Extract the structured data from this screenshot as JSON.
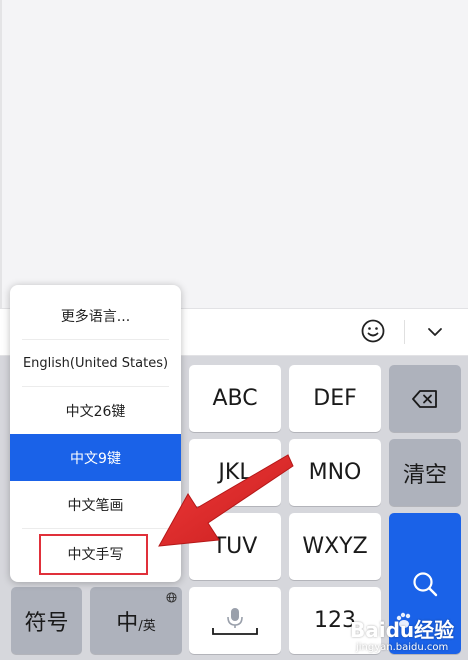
{
  "toolbar": {
    "emoji_icon": "smiley-icon",
    "collapse_icon": "chevron-down-icon"
  },
  "language_menu": {
    "items": [
      {
        "label": "更多语言..."
      },
      {
        "label": "English(United States)"
      },
      {
        "label": "中文26键"
      },
      {
        "label": "中文9键",
        "selected": true
      },
      {
        "label": "中文笔画"
      },
      {
        "label": "中文手写",
        "highlighted": true
      }
    ],
    "selected_color": "#1a62e8",
    "highlight_color": "#e0303a"
  },
  "keyboard": {
    "keys": {
      "abc": "ABC",
      "def": "DEF",
      "jkl": "JKL",
      "mno": "MNO",
      "tuv": "TUV",
      "wxyz": "WXYZ",
      "clear": "清空",
      "symbols": "符号",
      "zh": "中",
      "zh_en_sep": "/英",
      "num": "123"
    },
    "accent_color": "#1a62e8"
  },
  "watermark": {
    "main": "Baidu经验",
    "sub": "jingyan.baidu.com"
  }
}
